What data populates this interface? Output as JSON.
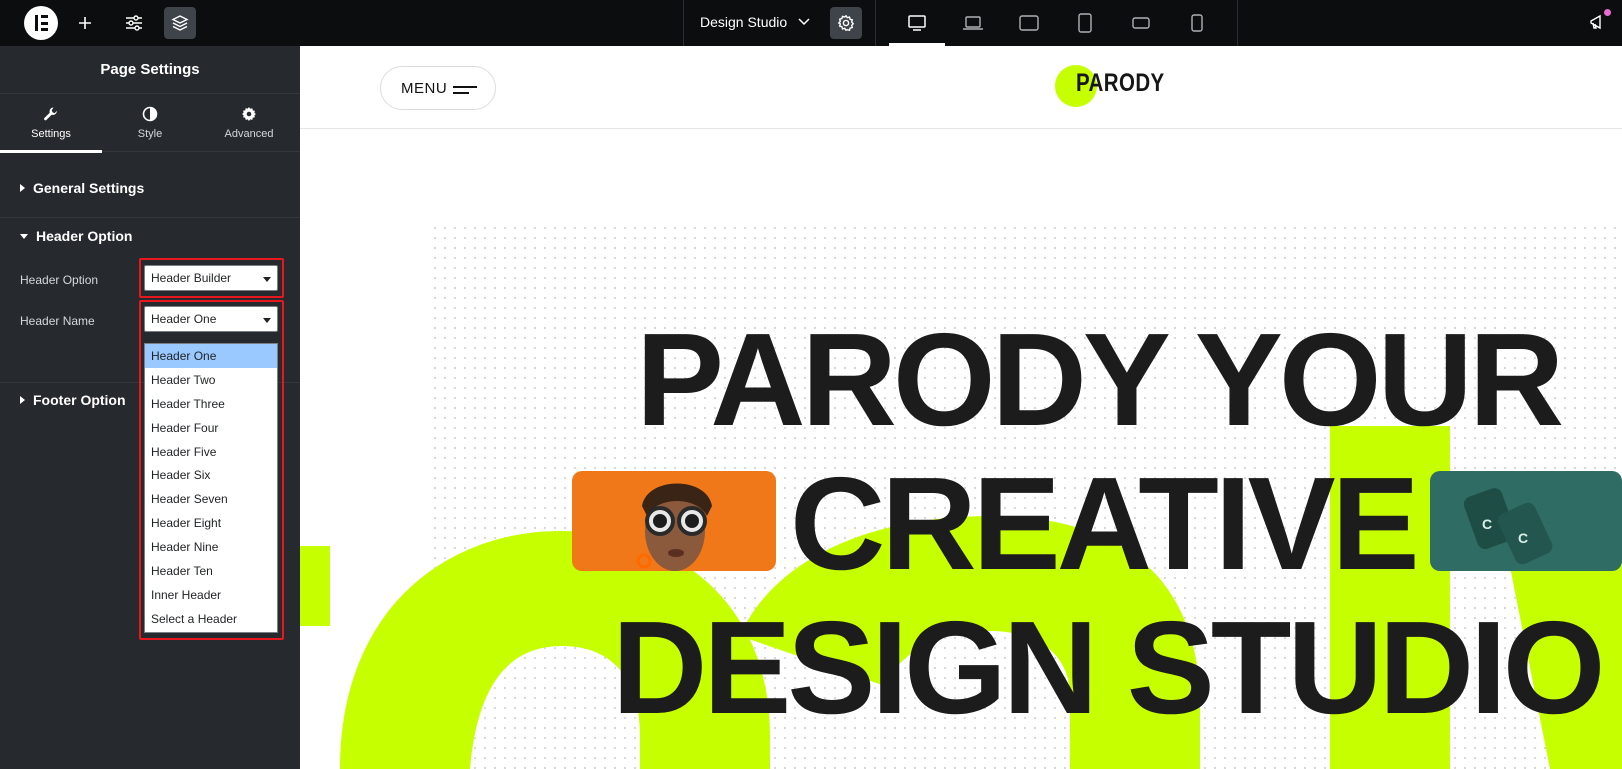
{
  "topbar": {
    "document_title": "Design Studio",
    "icons": [
      "elementor-logo-icon",
      "add-element-icon",
      "site-settings-icon",
      "structure-icon",
      "chevron-down-icon",
      "page-settings-gear-icon",
      "desktop-icon",
      "laptop-icon",
      "tablet-landscape-icon",
      "tablet-portrait-icon",
      "mobile-landscape-icon",
      "mobile-portrait-icon",
      "announcements-icon"
    ]
  },
  "panel": {
    "title": "Page Settings",
    "tabs": [
      {
        "label": "Settings",
        "icon": "wrench-icon",
        "active": true
      },
      {
        "label": "Style",
        "icon": "half-circle-icon",
        "active": false
      },
      {
        "label": "Advanced",
        "icon": "gear-icon",
        "active": false
      }
    ],
    "sections": {
      "general": "General Settings",
      "header": "Header Option",
      "footer": "Footer Option"
    },
    "fields": {
      "header_option_label": "Header Option",
      "header_option_value": "Header Builder",
      "header_name_label": "Header Name",
      "header_name_value": "Header One"
    },
    "header_name_options": [
      "Header One",
      "Header Two",
      "Header Three",
      "Header Four",
      "Header Five",
      "Header Six",
      "Header Seven",
      "Header Eight",
      "Header Nine",
      "Header Ten",
      "Inner Header",
      "Select a Header"
    ],
    "highlight_color": "#e8171e",
    "selected_option_color": "#99c9ff"
  },
  "canvas": {
    "menu_label": "MENU",
    "logo_text": "PARODY",
    "accent_color": "#c6ff00",
    "hero_lines": [
      "PARODY YOUR",
      "CREATIVE",
      "DESIGN STUDIO"
    ]
  }
}
